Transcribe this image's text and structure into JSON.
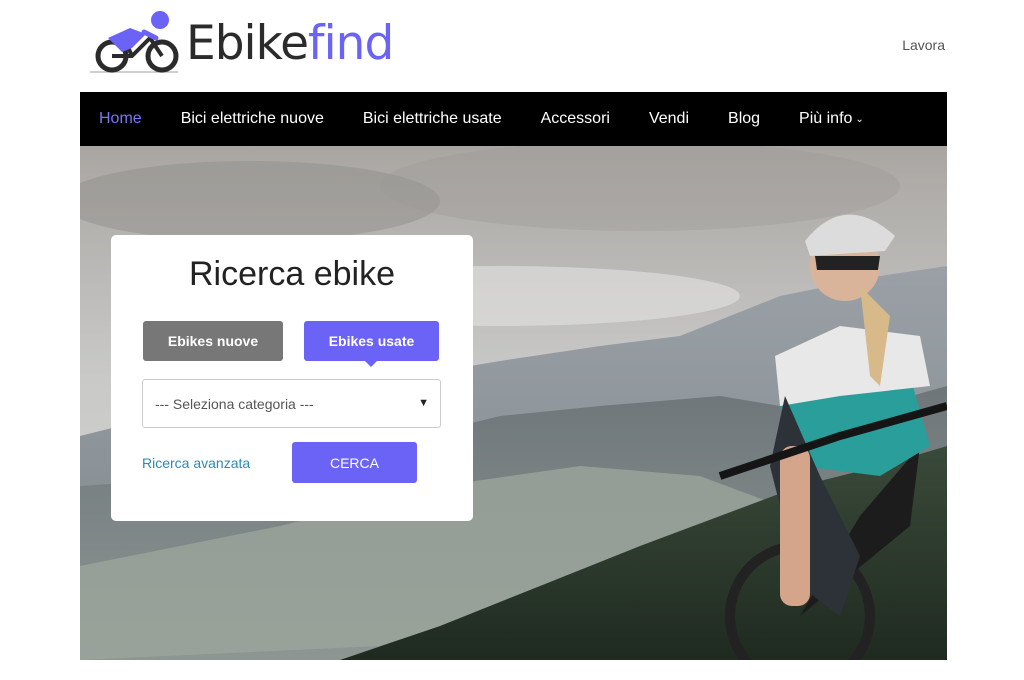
{
  "header": {
    "logo_dark": "Ebike",
    "logo_accent": "find",
    "right_link": "Lavora"
  },
  "nav": {
    "items": [
      {
        "label": "Home",
        "active": true
      },
      {
        "label": "Bici elettriche nuove"
      },
      {
        "label": "Bici elettriche usate"
      },
      {
        "label": "Accessori"
      },
      {
        "label": "Vendi"
      },
      {
        "label": "Blog"
      },
      {
        "label": "Più info",
        "has_dropdown": true
      }
    ],
    "dropdown_chevron": "⌄"
  },
  "search": {
    "title": "Ricerca ebike",
    "tabs": [
      {
        "label": "Ebikes nuove",
        "selected": false
      },
      {
        "label": "Ebikes usate",
        "selected": true
      }
    ],
    "category_select": "--- Seleziona categoria ---",
    "advanced_link": "Ricerca avanzata",
    "submit_label": "CERCA"
  },
  "colors": {
    "accent": "#6b63f5",
    "nav_bg": "#000000",
    "tab_inactive": "#777777",
    "link": "#2a8ab8"
  },
  "icons": {
    "logo": "cyclist-logo-icon",
    "select_arrow": "triangle-down-icon"
  }
}
